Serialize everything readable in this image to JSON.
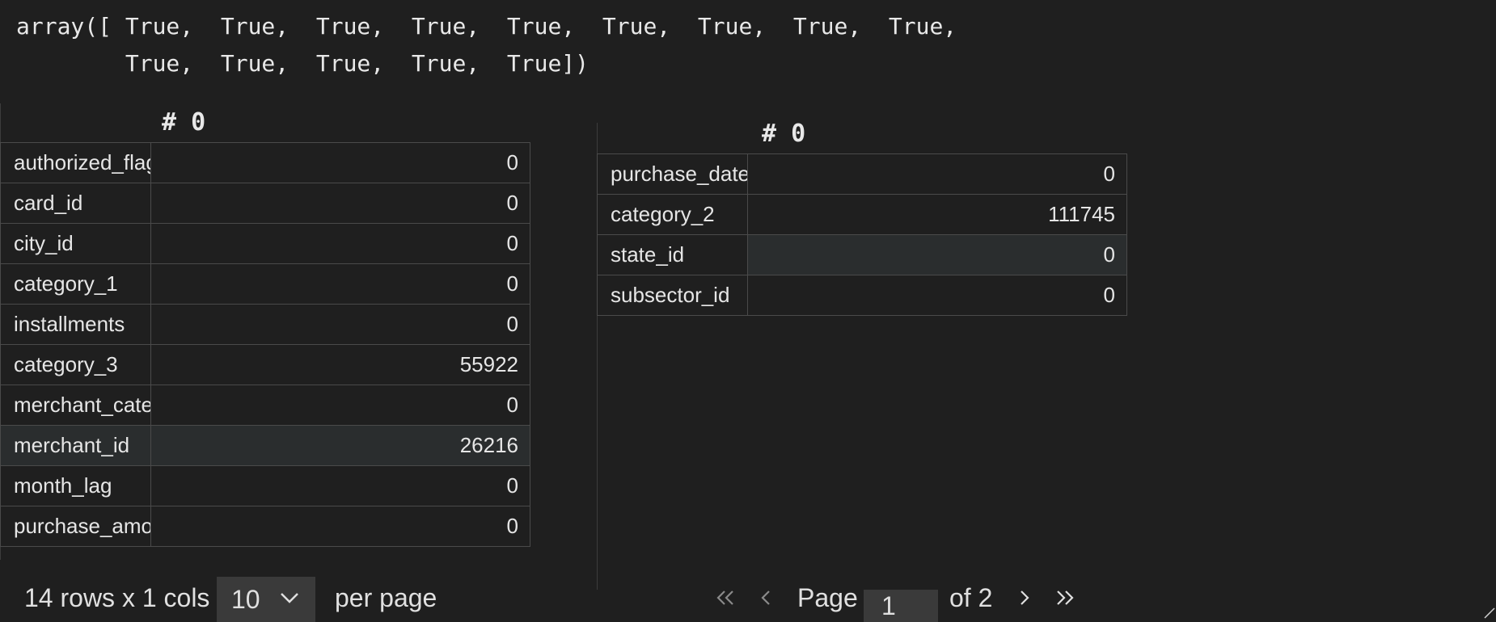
{
  "output": {
    "line1": "array([ True,  True,  True,  True,  True,  True,  True,  True,  True,",
    "line2": "        True,  True,  True,  True,  True])"
  },
  "left_table": {
    "column_header": "# 0",
    "rows": [
      {
        "index": "authorized_flag",
        "value": "0"
      },
      {
        "index": "card_id",
        "value": "0"
      },
      {
        "index": "city_id",
        "value": "0"
      },
      {
        "index": "category_1",
        "value": "0"
      },
      {
        "index": "installments",
        "value": "0"
      },
      {
        "index": "category_3",
        "value": "55922"
      },
      {
        "index": "merchant_category_id",
        "value": "0"
      },
      {
        "index": "merchant_id",
        "value": "26216"
      },
      {
        "index": "month_lag",
        "value": "0"
      },
      {
        "index": "purchase_amount",
        "value": "0"
      }
    ]
  },
  "right_table": {
    "column_header": "# 0",
    "rows": [
      {
        "index": "purchase_date",
        "value": "0"
      },
      {
        "index": "category_2",
        "value": "111745"
      },
      {
        "index": "state_id",
        "value": "0"
      },
      {
        "index": "subsector_id",
        "value": "0"
      }
    ]
  },
  "pager": {
    "rows_info": "14 rows x 1 cols",
    "page_size": "10",
    "per_page_label": "per page",
    "page_label": "Page",
    "current_page": "1",
    "of_label": "of 2",
    "icons": [
      "first-page-icon",
      "prev-page-icon",
      "next-page-icon",
      "last-page-icon",
      "chevron-down-icon"
    ]
  }
}
